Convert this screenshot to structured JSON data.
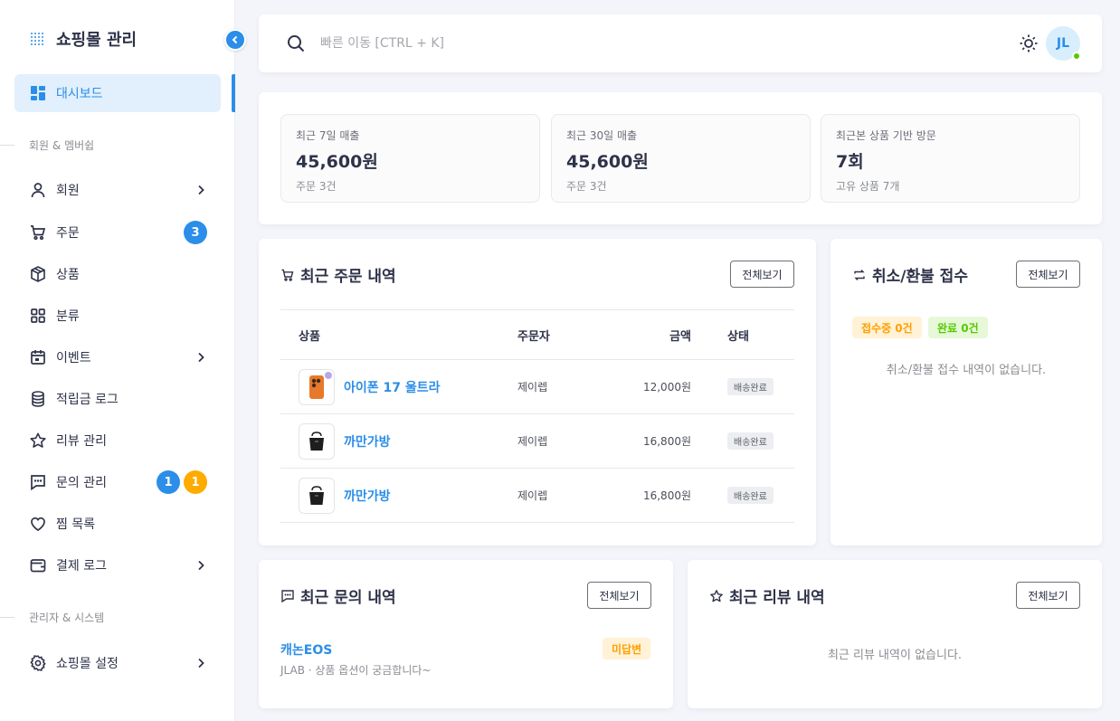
{
  "brand": {
    "title": "쇼핑몰 관리"
  },
  "sidebar": {
    "dashboard": "대시보드",
    "section1": "회원 & 멤버쉽",
    "members": "회원",
    "orders": "주문",
    "orders_badge": "3",
    "products": "상품",
    "categories": "분류",
    "events": "이벤트",
    "points_log": "적립금 로그",
    "reviews": "리뷰 관리",
    "inquiries": "문의 관리",
    "inquiries_badge_blue": "1",
    "inquiries_badge_orange": "1",
    "wishlist": "찜 목록",
    "payment_log": "결제 로그",
    "section2": "관리자 & 시스템",
    "settings": "쇼핑몰 설정"
  },
  "header": {
    "search_placeholder": "빠른 이동 [CTRL + K]",
    "avatar_initials": "JL"
  },
  "stats": [
    {
      "label": "최근 7일 매출",
      "value": "45,600원",
      "sub": "주문 3건"
    },
    {
      "label": "최근 30일 매출",
      "value": "45,600원",
      "sub": "주문 3건"
    },
    {
      "label": "최근본 상품 기반 방문",
      "value": "7회",
      "sub": "고유 상품 7개"
    }
  ],
  "recent_orders": {
    "title": "최근 주문 내역",
    "view_all": "전체보기",
    "columns": {
      "product": "상품",
      "buyer": "주문자",
      "amount": "금액",
      "status": "상태"
    },
    "rows": [
      {
        "product": "아이폰 17 울트라",
        "buyer": "제이렙",
        "amount": "12,000원",
        "status": "배송완료"
      },
      {
        "product": "까만가방",
        "buyer": "제이렙",
        "amount": "16,800원",
        "status": "배송완료"
      },
      {
        "product": "까만가방",
        "buyer": "제이렙",
        "amount": "16,800원",
        "status": "배송완료"
      }
    ]
  },
  "refunds": {
    "title": "취소/환불 접수",
    "view_all": "전체보기",
    "chip_pending": "접수중 0건",
    "chip_done": "완료 0건",
    "empty": "취소/환불 접수 내역이 없습니다."
  },
  "inquiries": {
    "title": "최근 문의 내역",
    "view_all": "전체보기",
    "item_title": "캐논EOS",
    "item_meta": "JLAB · 상품 옵션이 궁금합니다~",
    "item_status": "미답변"
  },
  "reviews": {
    "title": "최근 리뷰 내역",
    "view_all": "전체보기",
    "empty": "최근 리뷰 내역이 없습니다."
  },
  "colors": {
    "primary": "#2b8ee8",
    "warning": "#ffab00",
    "success": "#56ca00"
  }
}
